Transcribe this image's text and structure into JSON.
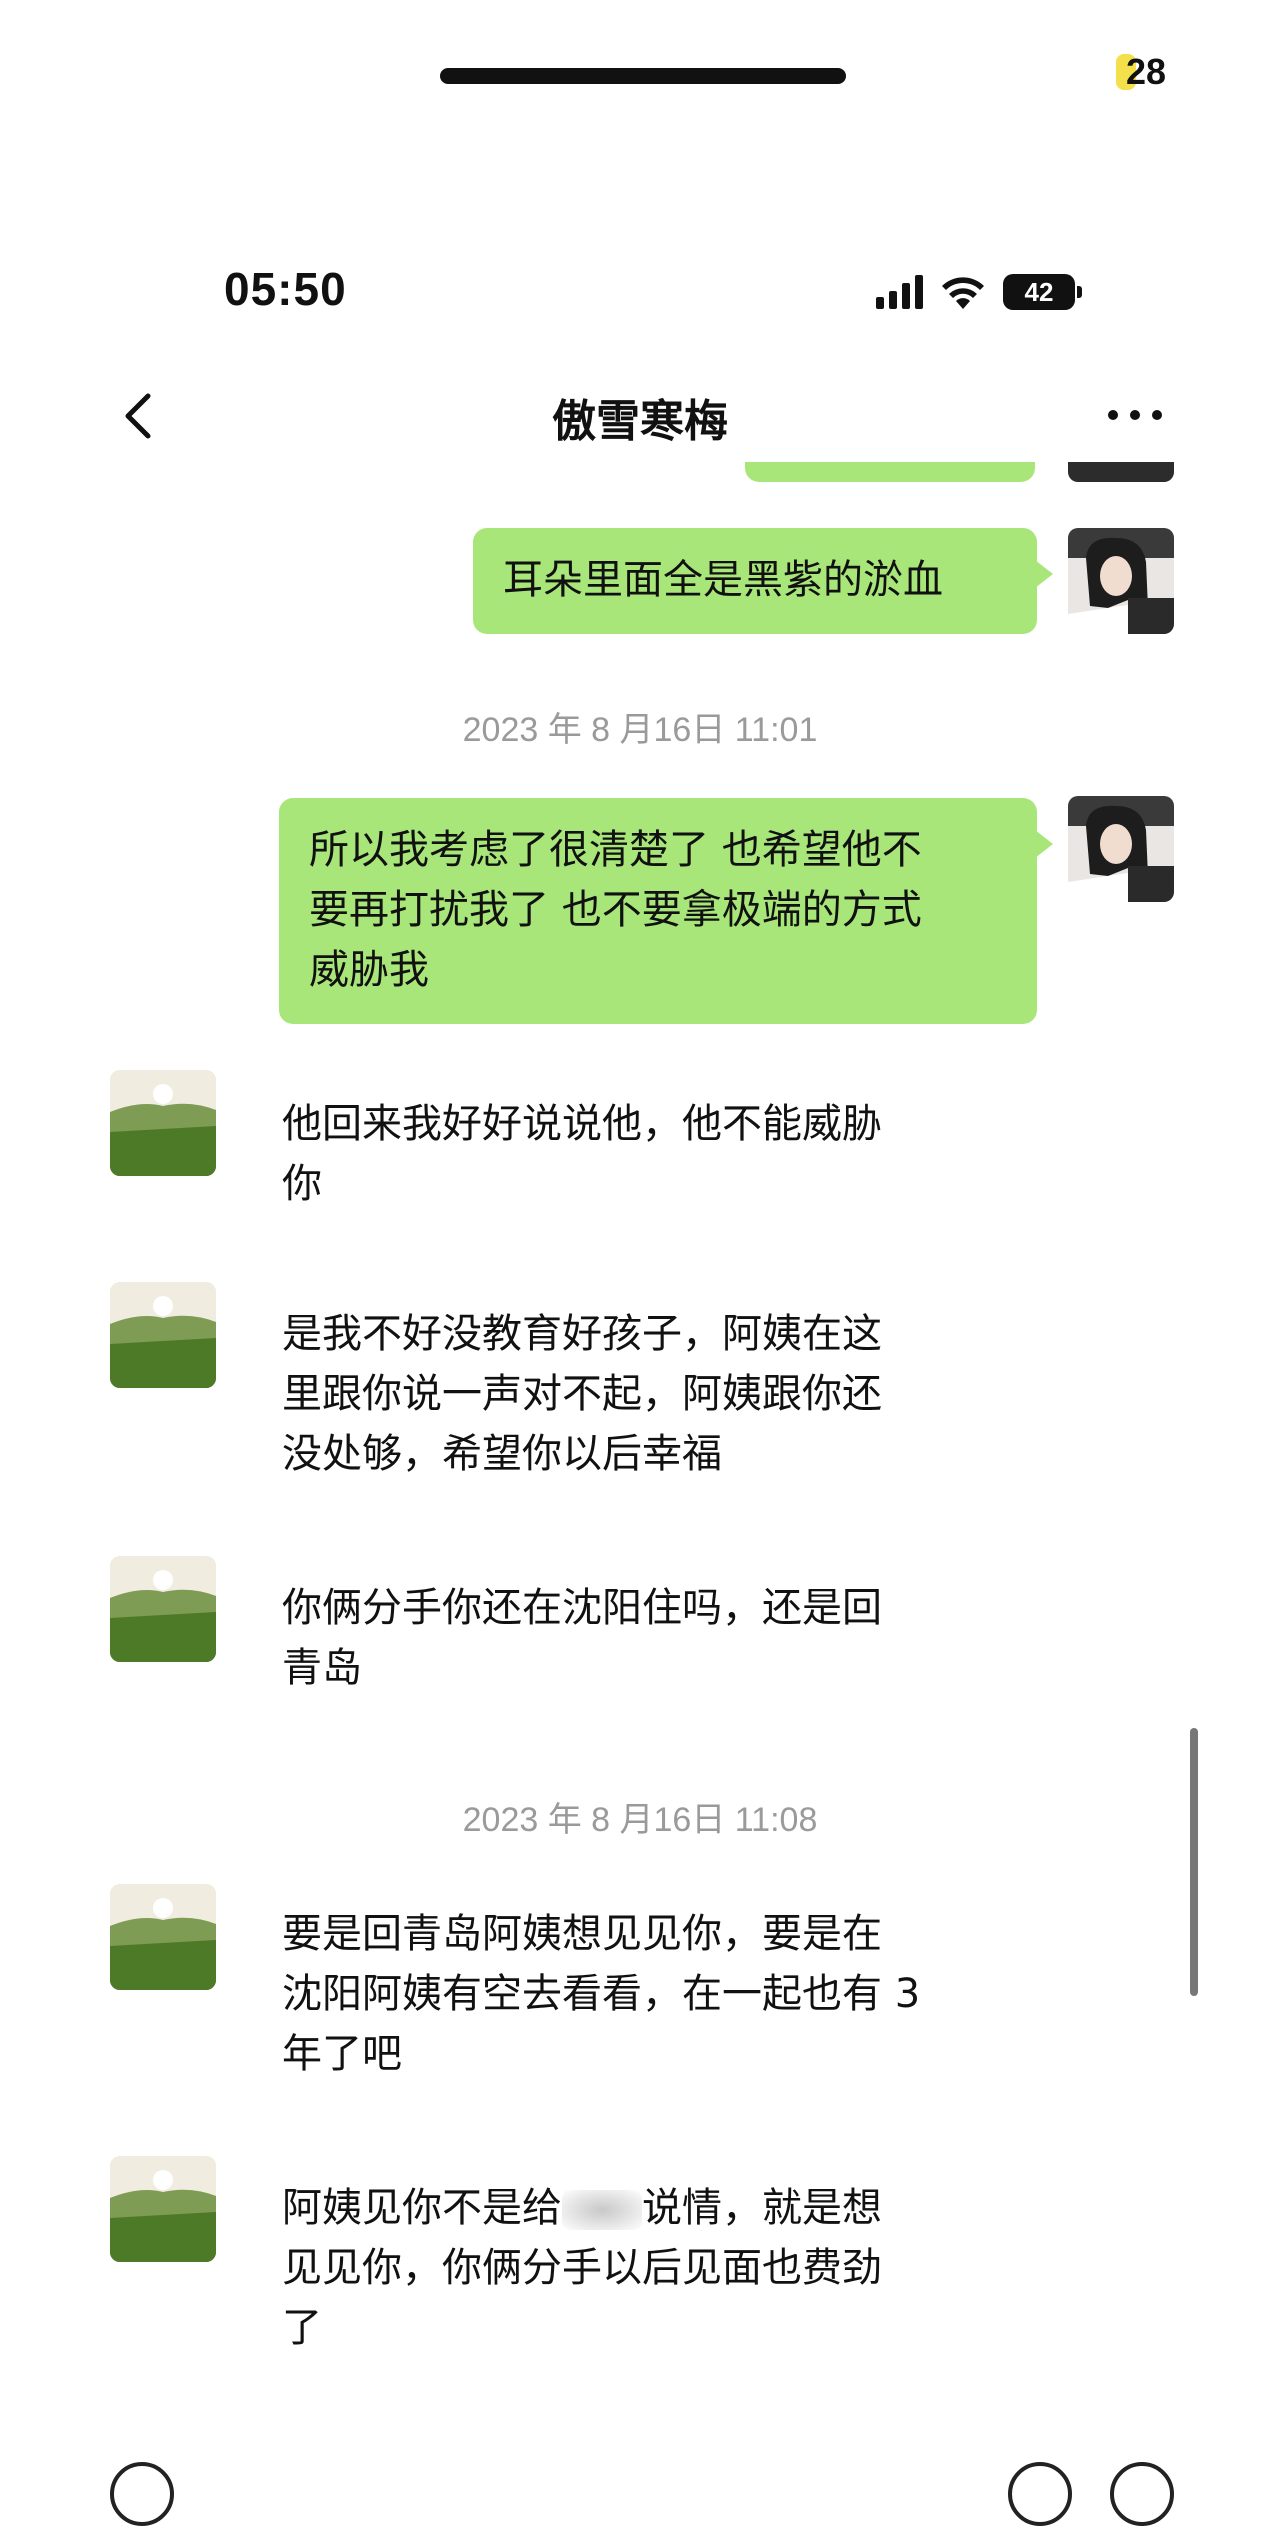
{
  "system": {
    "corner_count": "28",
    "time": "05:50",
    "battery": "42"
  },
  "header": {
    "title": "傲雪寒梅"
  },
  "messages": [
    {
      "side": "me",
      "text": "耳朵里面全是黑紫的淤血"
    },
    {
      "type": "timestamp",
      "text": "2023 年 8 月16日 11:01"
    },
    {
      "side": "me",
      "lines": [
        "所以我考虑了很清楚了 也希望他不",
        "要再打扰我了 也不要拿极端的方式",
        "威胁我"
      ]
    },
    {
      "side": "other",
      "lines": [
        "他回来我好好说说他，他不能威胁",
        "你"
      ]
    },
    {
      "side": "other",
      "lines": [
        "是我不好没教育好孩子，阿姨在这",
        "里跟你说一声对不起，阿姨跟你还",
        "没处够，希望你以后幸福"
      ]
    },
    {
      "side": "other",
      "lines": [
        "你俩分手你还在沈阳住吗，还是回",
        "青岛"
      ]
    },
    {
      "type": "timestamp",
      "text": "2023 年 8 月16日 11:08"
    },
    {
      "side": "other",
      "lines": [
        "要是回青岛阿姨想见见你，要是在",
        "沈阳阿姨有空去看看，在一起也有 3",
        "年了吧"
      ]
    },
    {
      "side": "other",
      "lines": [
        "阿姨见你不是给",
        "说情，就是想",
        "见见你，你俩分手以后见面也费劲",
        "了"
      ]
    }
  ],
  "icons": {
    "back": "chevron-left-icon",
    "more": "more-dots-icon",
    "signal": "signal-icon",
    "wifi": "wifi-icon",
    "battery": "battery-icon"
  },
  "colors": {
    "my_bubble": "#a8e67a",
    "timestamp": "#9a9a9a"
  }
}
